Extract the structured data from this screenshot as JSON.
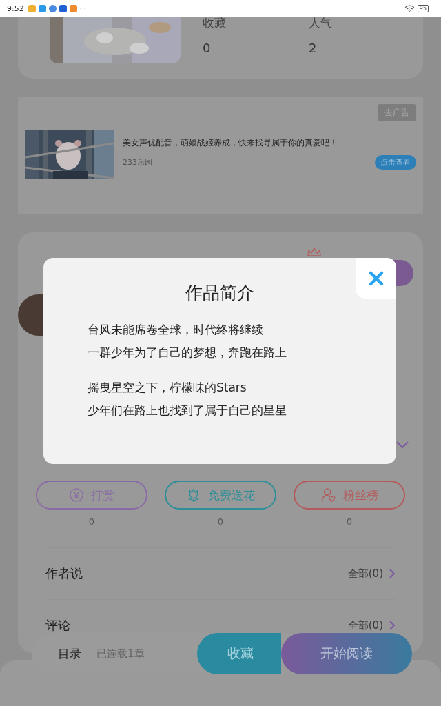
{
  "status_bar": {
    "time": "9:52",
    "more": "···",
    "battery": "95"
  },
  "book_card": {
    "stats": [
      {
        "label": "收藏",
        "value": "0"
      },
      {
        "label": "人气",
        "value": "2"
      }
    ]
  },
  "ad": {
    "remove_button": "去广告",
    "title": "美女声优配音，萌娘战姬养成，快来找寻属于你的真爱吧！",
    "source": "233乐园",
    "action_button": "点击查看"
  },
  "rewards": [
    {
      "kind": "coin",
      "label": "打赏",
      "count": "0",
      "color": "#8a6aa6"
    },
    {
      "kind": "flower",
      "label": "免费送花",
      "count": "0",
      "color": "#2e8f98"
    },
    {
      "kind": "fans",
      "label": "粉丝榜",
      "count": "0",
      "color": "#b55a5a"
    }
  ],
  "sections": [
    {
      "title": "作者说",
      "link": "全部(0)"
    },
    {
      "title": "评论",
      "link": "全部(0)"
    }
  ],
  "bottom_bar": {
    "catalog": "目录",
    "progress": "已连载1章",
    "favorite_button": "收藏",
    "read_button": "开始阅读"
  },
  "modal": {
    "title": "作品简介",
    "paragraphs": [
      [
        "台风未能席卷全球，时代终将继续",
        "一群少年为了自己的梦想，奔跑在路上"
      ],
      [
        "摇曳星空之下，柠檬味的Stars",
        "少年们在路上也找到了属于自己的星星"
      ]
    ]
  }
}
